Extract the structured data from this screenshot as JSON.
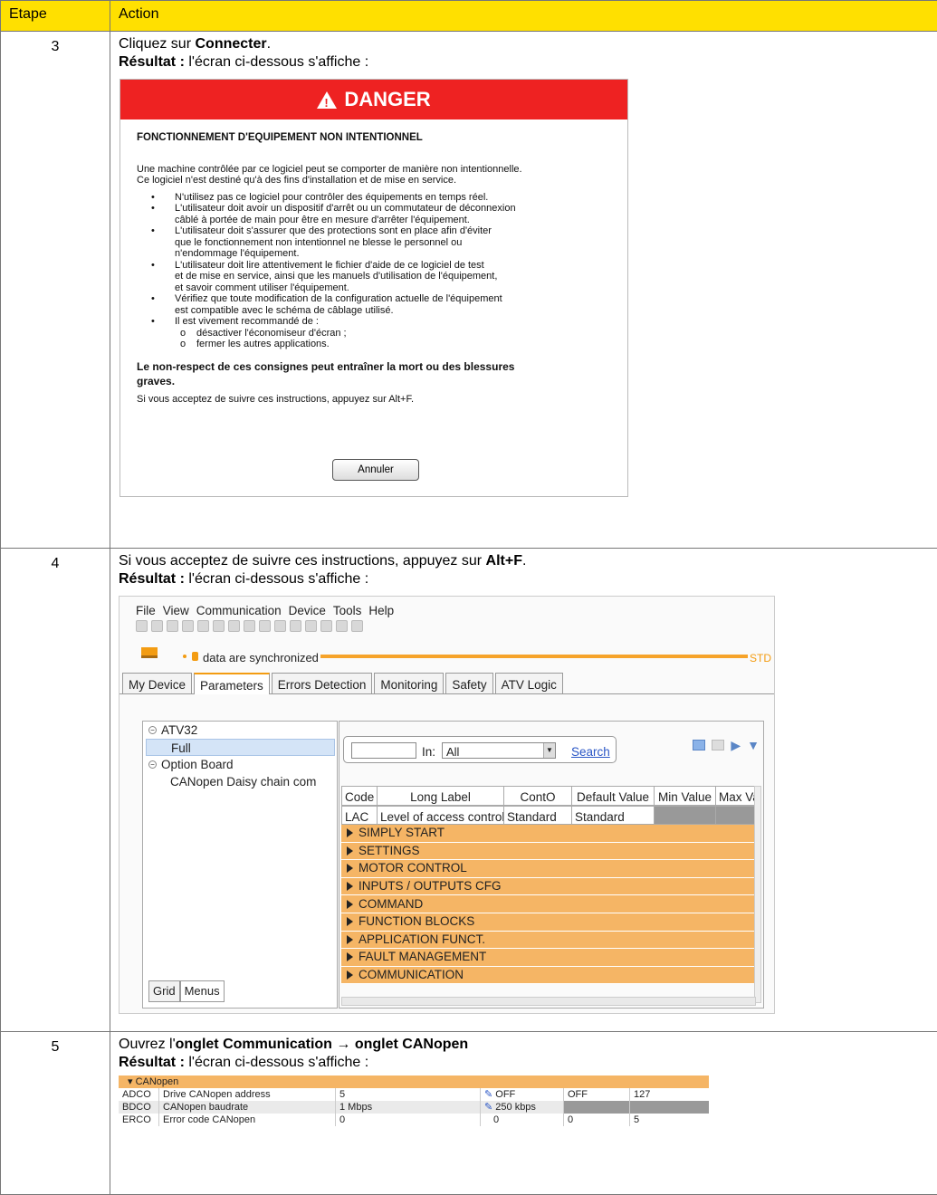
{
  "table": {
    "col_step": "Etape",
    "col_action": "Action"
  },
  "row3": {
    "step": "3",
    "line1_prefix": "Cliquez sur ",
    "line1_bold": "Connecter",
    "line1_suffix": ".",
    "result_label": "Résultat :",
    "result_text": " l'écran ci-dessous s'affiche :",
    "dialog": {
      "header": "DANGER",
      "title": "FONCTIONNEMENT D'EQUIPEMENT NON INTENTIONNEL",
      "intro1": "Une machine contrôlée par ce logiciel peut se comporter de manière non intentionnelle.",
      "intro2": "Ce logiciel n'est destiné qu'à des fins d'installation et de mise en service.",
      "b1": "N'utilisez pas ce logiciel pour contrôler des équipements en temps réel.",
      "b2a": "L'utilisateur doit avoir un dispositif d'arrêt ou un commutateur de déconnexion",
      "b2b": "câblé à portée de main pour être en mesure d'arrêter l'équipement.",
      "b3a": "L'utilisateur doit s'assurer que des protections sont en place afin d'éviter",
      "b3b": "que le fonctionnement non intentionnel ne blesse le personnel ou",
      "b3c": "n'endommage l'équipement.",
      "b4a": "L'utilisateur doit lire attentivement le fichier d'aide de ce logiciel de test",
      "b4b": "et de mise en service, ainsi que les manuels d'utilisation de l'équipement,",
      "b4c": "et savoir comment utiliser l'équipement.",
      "b5a": "Vérifiez que toute modification de la configuration actuelle de l'équipement",
      "b5b": "est compatible avec le schéma de câblage utilisé.",
      "b6": "Il est vivement recommandé de :",
      "s1": "désactiver l'économiseur d'écran ;",
      "s2": "fermer les autres applications.",
      "warning1": "Le non-respect de ces consignes peut entraîner la mort ou des blessures",
      "warning2": "graves.",
      "footer": "Si vous acceptez de suivre ces instructions, appuyez sur Alt+F.",
      "cancel": "Annuler"
    }
  },
  "row4": {
    "step": "4",
    "line1_prefix": "Si vous acceptez de suivre ces instructions, appuyez sur ",
    "line1_bold": "Alt+F",
    "line1_suffix": ".",
    "result_label": "Résultat :",
    "result_text": " l'écran ci-dessous s'affiche :",
    "app": {
      "menu": [
        "File",
        "View",
        "Communication",
        "Device",
        "Tools",
        "Help"
      ],
      "sync_text": "data are synchronized",
      "sync_std": "STD",
      "tabs": [
        "My Device",
        "Parameters",
        "Errors Detection",
        "Monitoring",
        "Safety",
        "ATV Logic"
      ],
      "tree": {
        "root": "ATV32",
        "full": "Full",
        "option": "Option Board",
        "canopen": "CANopen Daisy chain com"
      },
      "bottom_tabs": [
        "Grid",
        "Menus"
      ],
      "search": {
        "in_label": "In:",
        "in_value": "All",
        "link": "Search"
      },
      "grid_headers": [
        "Code",
        "Long Label",
        "ContO",
        "Default Value",
        "Min Value",
        "Max Va"
      ],
      "grid_row": [
        "LAC",
        "Level of access control",
        "Standard",
        "Standard"
      ],
      "menus": [
        "SIMPLY START",
        "SETTINGS",
        "MOTOR CONTROL",
        "INPUTS / OUTPUTS CFG",
        "COMMAND",
        "FUNCTION BLOCKS",
        "APPLICATION FUNCT.",
        "FAULT MANAGEMENT",
        "COMMUNICATION"
      ]
    }
  },
  "row5": {
    "step": "5",
    "line1_prefix": "Ouvrez l'",
    "line1_bold": "onglet Communication → onglet CANopen",
    "result_label": "Résultat :",
    "result_text": " l'écran ci-dessous s'affiche :",
    "canopen": {
      "header": "CANopen",
      "rows": [
        [
          "ADCO",
          "Drive CANopen address",
          "5",
          "OFF",
          "OFF",
          "127"
        ],
        [
          "BDCO",
          "CANopen baudrate",
          "1 Mbps",
          "250 kbps",
          "",
          ""
        ],
        [
          "ERCO",
          "Error code CANopen",
          "0",
          "0",
          "0",
          "5"
        ]
      ]
    }
  },
  "colors": {
    "header_yellow": "#ffe000",
    "danger_red": "#ee2222",
    "menu_orange": "#f5b565",
    "accent": "#f39c12"
  }
}
